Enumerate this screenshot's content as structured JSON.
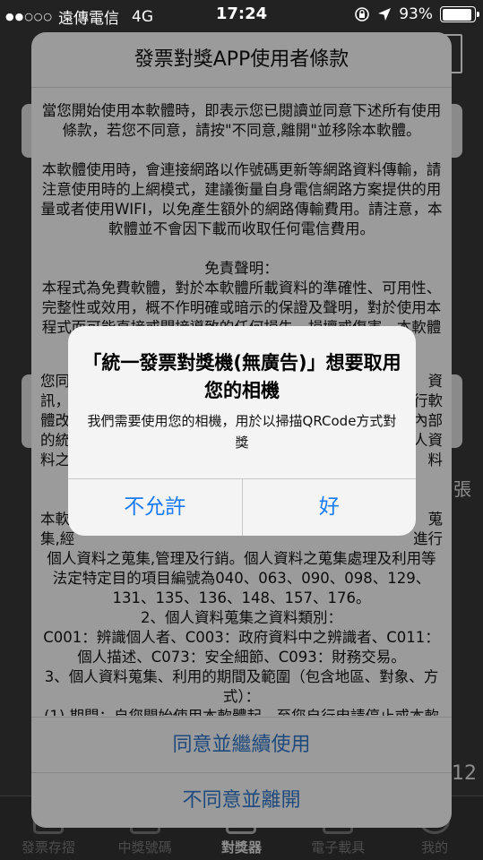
{
  "status_bar": {
    "signal": "●●○○○",
    "carrier": "遠傳電信",
    "network": "4G",
    "time": "17:24",
    "battery": "93%",
    "battery_level": 0.93,
    "icons": [
      "rotation-lock-icon",
      "location-arrow-icon",
      "battery-icon"
    ]
  },
  "background": {
    "side_text_1": "張",
    "side_text_2": "12",
    "tabs": [
      {
        "label": "發票存摺",
        "active": false
      },
      {
        "label": "中獎號碼",
        "active": false
      },
      {
        "label": "對獎器",
        "active": true
      },
      {
        "label": "電子載具",
        "active": false
      },
      {
        "label": "我的",
        "active": false
      }
    ]
  },
  "terms": {
    "title": "發票對獎APP使用者條款",
    "paragraphs": [
      "當您開始使用本軟體時，即表示您已閱讀並同意下述所有使用條款，若您不同意，請按\"不同意,離開\"並移除本軟體。",
      "本軟體使用時，會連接網路以作號碼更新等網路資料傳輸，請注意使用時的上網模式，建議衡量自身電信網路方案提供的用量或者使用WIFI，以免產生額外的網路傳輸費用。請注意，本軟體並不會因下載而收取任何電信費用。",
      "免責聲明：",
      "本程式為免費軟體，對於本軟體所載資料的準確性、可用性、完整性或效用，概不作明確或暗示的保證及聲明，對於使用本程式而可能直接或間接導致的任何損失、損壞或傷害，本軟體之開發者不負任何法律承擔和責任。"
    ],
    "partial_left": [
      "您同",
      "訊，",
      "體改",
      "的統",
      "料之"
    ],
    "partial_right": [
      "資",
      "行軟",
      "內部",
      "人資",
      "料"
    ],
    "section2_partial_left": [
      "本軟",
      "集,經"
    ],
    "section2_partial_right": [
      "蒐",
      "進行"
    ],
    "section2_lines": [
      "個人資料之蒐集,管理及行銷。個人資料之蒐集處理及利用等法定特定目的項目編號為040、063、090、098、129、131、135、136、148、157、176。",
      "2、個人資料蒐集之資料類別：",
      "C001：辨識個人者、C003：政府資料中之辨識者、C011：個人描述、C073：安全細節、C093：財務交易。",
      "3、個人資料蒐集、利用的期間及範圍（包含地區、對象、方式）：",
      "(1) 期間：自您開始使用本軟體起，至您自行申請停止或本軟體終止您的會員契約之日止，或是本軟體各項活動辦法揭載之使用到期日止。但若法令另有規定者，依其規定。"
    ],
    "agree_label": "同意並繼續使用",
    "disagree_label": "不同意並離開"
  },
  "alert": {
    "title": "「統一發票對獎機(無廣告)」想要取用您的相機",
    "message": "我們需要使用您的相機，用於以掃描QRCode方式對獎",
    "deny_label": "不允許",
    "allow_label": "好",
    "accent_color": "#1a7cf5"
  }
}
